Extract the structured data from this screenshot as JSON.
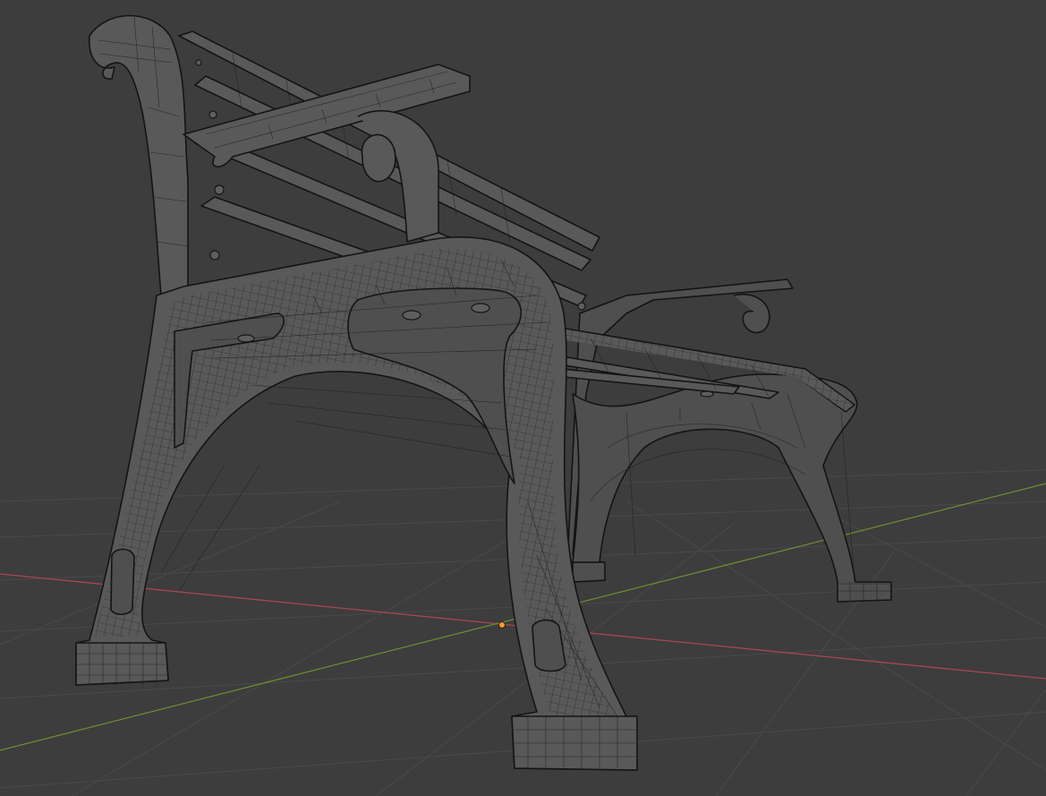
{
  "viewport": {
    "editor": "3D Viewport",
    "shading": "wireframe",
    "object": "park-bench",
    "colors": {
      "background": "#3d3d3d",
      "grid": "#4a4a4a",
      "x_axis": "#a8474f",
      "y_axis": "#6c8e31",
      "origin": "#ff9b2e",
      "wire": "#141414",
      "surface": "#595959"
    }
  }
}
